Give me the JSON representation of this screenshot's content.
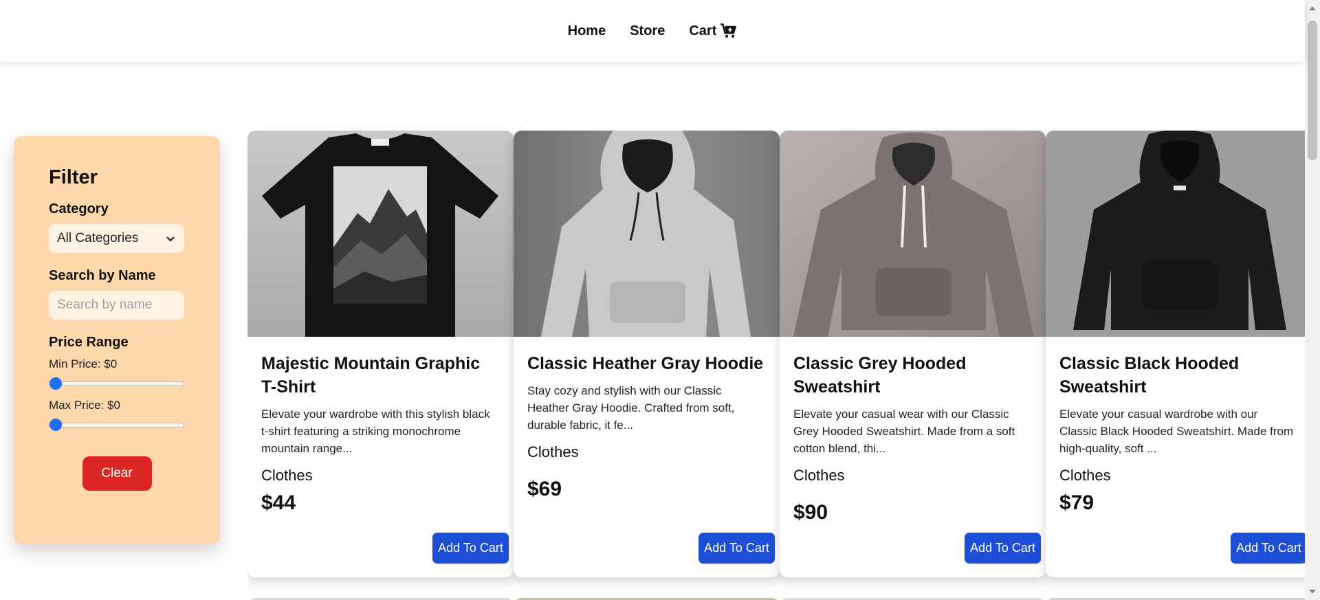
{
  "nav": {
    "home": "Home",
    "store": "Store",
    "cart": "Cart",
    "cart_icon": "cart-plus-icon"
  },
  "filter": {
    "title": "Filter",
    "category_label": "Category",
    "category_value": "All Categories",
    "search_label": "Search by Name",
    "search_placeholder": "Search by name",
    "price_label": "Price Range",
    "min_price": "Min Price: $0",
    "max_price": "Max Price: $0",
    "clear": "Clear"
  },
  "products": [
    {
      "title": "Majestic Mountain Graphic T-Shirt",
      "description": "Elevate your wardrobe with this stylish black t-shirt featuring a striking monochrome mountain range...",
      "category": "Clothes",
      "price": "$44",
      "button": "Add To Cart"
    },
    {
      "title": "Classic Heather Gray Hoodie",
      "description": "Stay cozy and stylish with our Classic Heather Gray Hoodie. Crafted from soft, durable fabric, it fe...",
      "category": "Clothes",
      "price": "$69",
      "button": "Add To Cart"
    },
    {
      "title": "Classic Grey Hooded Sweatshirt",
      "description": "Elevate your casual wear with our Classic Grey Hooded Sweatshirt. Made from a soft cotton blend, thi...",
      "category": "Clothes",
      "price": "$90",
      "button": "Add To Cart"
    },
    {
      "title": "Classic Black Hooded Sweatshirt",
      "description": "Elevate your casual wardrobe with our Classic Black Hooded Sweatshirt. Made from high-quality, soft ...",
      "category": "Clothes",
      "price": "$79",
      "button": "Add To Cart"
    }
  ],
  "colors": {
    "filter_bg": "#fed7aa",
    "primary_button": "#1d4ed8",
    "clear_button": "#dc2626"
  }
}
